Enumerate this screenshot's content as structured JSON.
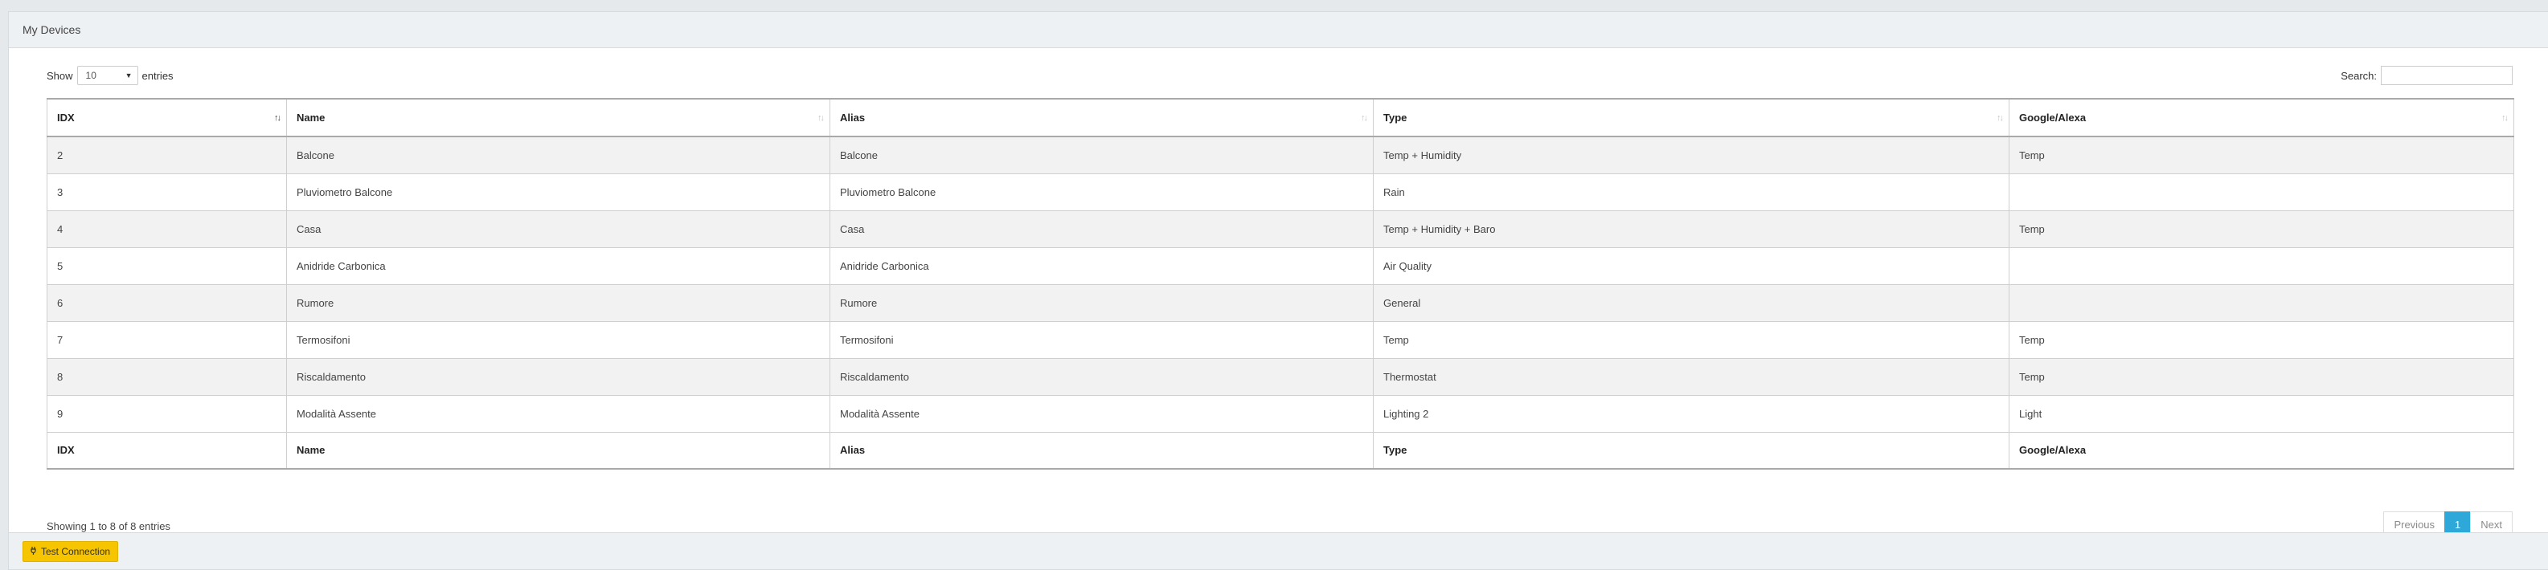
{
  "panel": {
    "title": "My Devices"
  },
  "length": {
    "prefix": "Show",
    "value": "10",
    "suffix": "entries"
  },
  "search": {
    "label": "Search:",
    "value": ""
  },
  "table": {
    "columns": [
      "IDX",
      "Name",
      "Alias",
      "Type",
      "Google/Alexa"
    ],
    "sorted_column": "IDX",
    "rows": [
      [
        "2",
        "Balcone",
        "Balcone",
        "Temp + Humidity",
        "Temp"
      ],
      [
        "3",
        "Pluviometro Balcone",
        "Pluviometro Balcone",
        "Rain",
        ""
      ],
      [
        "4",
        "Casa",
        "Casa",
        "Temp + Humidity + Baro",
        "Temp"
      ],
      [
        "5",
        "Anidride Carbonica",
        "Anidride Carbonica",
        "Air Quality",
        ""
      ],
      [
        "6",
        "Rumore",
        "Rumore",
        "General",
        ""
      ],
      [
        "7",
        "Termosifoni",
        "Termosifoni",
        "Temp",
        "Temp"
      ],
      [
        "8",
        "Riscaldamento",
        "Riscaldamento",
        "Thermostat",
        "Temp"
      ],
      [
        "9",
        "Modalità Assente",
        "Modalità Assente",
        "Lighting 2",
        "Light"
      ]
    ]
  },
  "info": "Showing 1 to 8 of 8 entries",
  "pagination": {
    "previous": "Previous",
    "current": "1",
    "next": "Next"
  },
  "footer": {
    "test_button": "Test Connection",
    "test_icon": "plug-icon"
  },
  "colors": {
    "accent": "#2ea8d8",
    "button": "#f7c400"
  }
}
